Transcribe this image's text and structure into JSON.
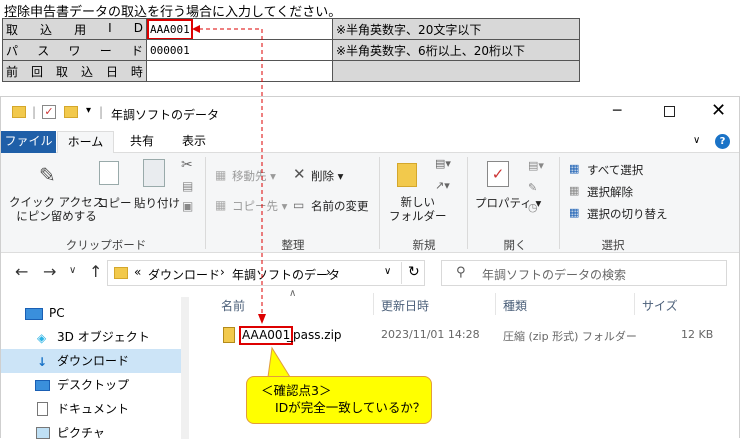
{
  "top_caption": "控除申告書データの取込を行う場合に入力してください。",
  "form": {
    "rows": [
      {
        "label_chars": [
          "取",
          "込",
          "用",
          "I",
          "D"
        ],
        "value": "AAA001",
        "note": "※半角英数字、20文字以下"
      },
      {
        "label_chars": [
          "パ",
          "ス",
          "ワ",
          "ー",
          "ド"
        ],
        "value": "000001",
        "note": "※半角英数字、6桁以上、20桁以下"
      },
      {
        "label_chars": [
          "前",
          "回",
          "取",
          "込",
          "日",
          "時"
        ],
        "value": "",
        "note": ""
      }
    ]
  },
  "window": {
    "title": "年調ソフトのデータ",
    "tabs": [
      "ファイル",
      "ホーム",
      "共有",
      "表示"
    ],
    "ribbon": {
      "quick_access": "クイック アクセス\nにピン留めする",
      "copy": "コピー",
      "paste": "貼り付け",
      "clipboard_group": "クリップボード",
      "move_to": "移動先",
      "delete": "削除",
      "copy_to": "コピー先",
      "rename": "名前の変更",
      "organize_group": "整理",
      "new_folder": "新しい\nフォルダー",
      "new_group": "新規",
      "properties": "プロパティ",
      "open_group": "開く",
      "select_all": "すべて選択",
      "select_none": "選択解除",
      "invert_selection": "選択の切り替え",
      "select_group": "選択"
    },
    "address": {
      "prefix": "«",
      "crumbs": [
        "ダウンロード",
        "年調ソフトのデータ"
      ]
    },
    "search_placeholder": "年調ソフトのデータの検索",
    "sidebar": [
      "PC",
      "3D オブジェクト",
      "ダウンロード",
      "デスクトップ",
      "ドキュメント",
      "ピクチャ"
    ],
    "columns": [
      "名前",
      "更新日時",
      "種類",
      "サイズ"
    ],
    "file": {
      "name_highlight": "AAA001",
      "name_rest": "_pass.zip",
      "modified": "2023/11/01 14:28",
      "type": "圧縮 (zip 形式) フォルダー",
      "size": "12 KB"
    }
  },
  "callout": {
    "line1": "＜確認点3＞",
    "line2": "IDが完全一致しているか？"
  },
  "colors": {
    "accent_blue": "#1a5fb4",
    "file_tab": "#1f5fa8",
    "callout_bg": "#ffff00",
    "highlight_red": "#dd0000",
    "selected_row": "#cce4f7"
  }
}
